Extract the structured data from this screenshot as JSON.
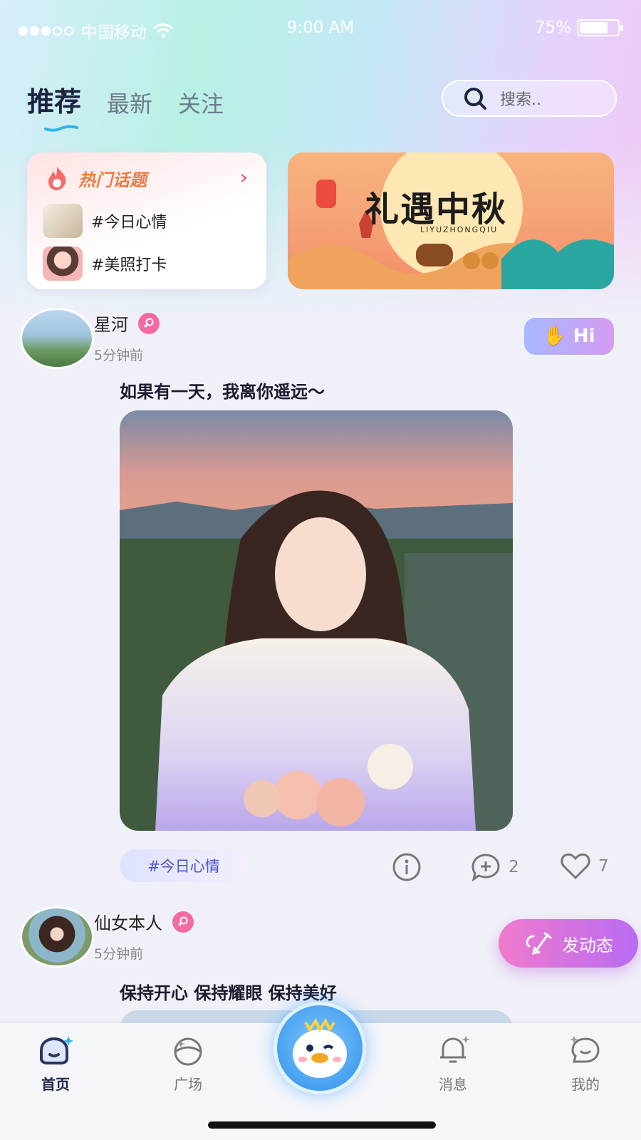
{
  "status_bar": {
    "carrier": "中国移动",
    "time": "9:00 AM",
    "battery": "75%",
    "battery_level": 0.75
  },
  "tabs": [
    {
      "label": "推荐",
      "active": true
    },
    {
      "label": "最新",
      "active": false
    },
    {
      "label": "关注",
      "active": false
    }
  ],
  "search": {
    "placeholder": "搜索.."
  },
  "hot_topics": {
    "title": "热门话题",
    "items": [
      {
        "label": "#今日心情"
      },
      {
        "label": "#美照打卡"
      }
    ]
  },
  "banner": {
    "title": "礼遇中秋",
    "subtitle": "LIYUZHONGQIU"
  },
  "posts": [
    {
      "username": "星河",
      "time": "5分钟前",
      "text": "如果有一天，我离你遥远～",
      "tag": "#今日心情",
      "comments": "2",
      "likes": "7",
      "hi_label": "Hi"
    },
    {
      "username": "仙女本人",
      "time": "5分钟前",
      "text": "保持开心 保持耀眼 保持美好"
    }
  ],
  "fab": {
    "label": "发动态"
  },
  "tab_bar": [
    {
      "label": "首页",
      "icon": "home-icon",
      "active": true
    },
    {
      "label": "广场",
      "icon": "planet-icon",
      "active": false
    },
    {
      "label": "消息",
      "icon": "bell-icon",
      "active": false
    },
    {
      "label": "我的",
      "icon": "chat-face-icon",
      "active": false
    }
  ],
  "colors": {
    "accent": "#b86cf3",
    "pink": "#f46aa3",
    "tag_text": "#4d56c8"
  }
}
